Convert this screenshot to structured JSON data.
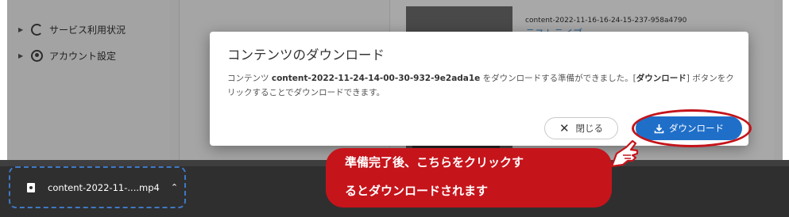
{
  "sidebar": {
    "items": [
      {
        "label": "サービス利用状況",
        "icon": "usage-icon"
      },
      {
        "label": "アカウント設定",
        "icon": "account-icon"
      }
    ]
  },
  "content_card": {
    "name": "content-2022-11-16-16-24-15-237-958a4790",
    "title": "テストライブ"
  },
  "dialog": {
    "title": "コンテンツのダウンロード",
    "message_prefix": "コンテンツ",
    "content_id": "content-2022-11-24-14-00-30-932-9e2ada1e",
    "message_middle": "をダウンロードする準備ができました。[",
    "message_bold_button": "ダウンロード",
    "message_suffix": "] ボタンをクリックすることでダウンロードできます。",
    "close_label": "閉じる",
    "download_label": "ダウンロード"
  },
  "download_shelf": {
    "filename": "content-2022-11-....mp4"
  },
  "callout": {
    "line1": "準備完了後、こちらをクリックす",
    "line2": "るとダウンロードされます"
  },
  "colors": {
    "primary_button": "#1f6fc9",
    "callout_red": "#c6141b",
    "highlight_dashed": "#3f79c6",
    "shelf_bg": "#2f2f2f"
  }
}
